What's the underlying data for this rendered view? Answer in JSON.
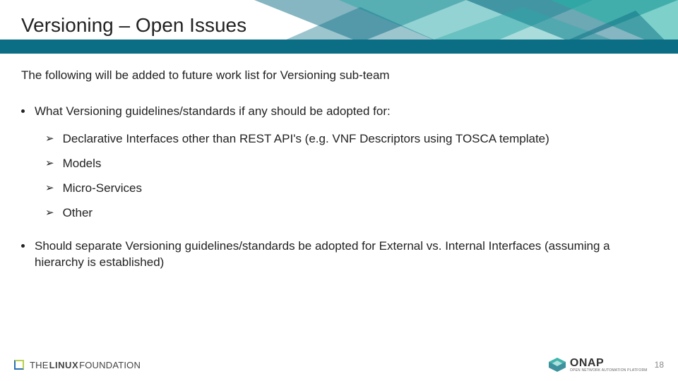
{
  "header": {
    "title": "Versioning – Open Issues"
  },
  "content": {
    "intro": "The following will be added to future work list for Versioning sub-team",
    "bullet1": "What Versioning guidelines/standards if any should be adopted for:",
    "subitems": {
      "a": "Declarative Interfaces other than REST API's (e.g. VNF Descriptors using TOSCA template)",
      "b": "Models",
      "c": "Micro-Services",
      "d": "Other"
    },
    "bullet2": "Should separate Versioning guidelines/standards be adopted for External vs. Internal Interfaces (assuming a hierarchy is established)"
  },
  "footer": {
    "lf_the": "THE",
    "lf_linux": "LINUX",
    "lf_fdn": "FOUNDATION",
    "onap_main": "ONAP",
    "onap_sub": "OPEN NETWORK AUTOMATION PLATFORM",
    "page": "18"
  }
}
